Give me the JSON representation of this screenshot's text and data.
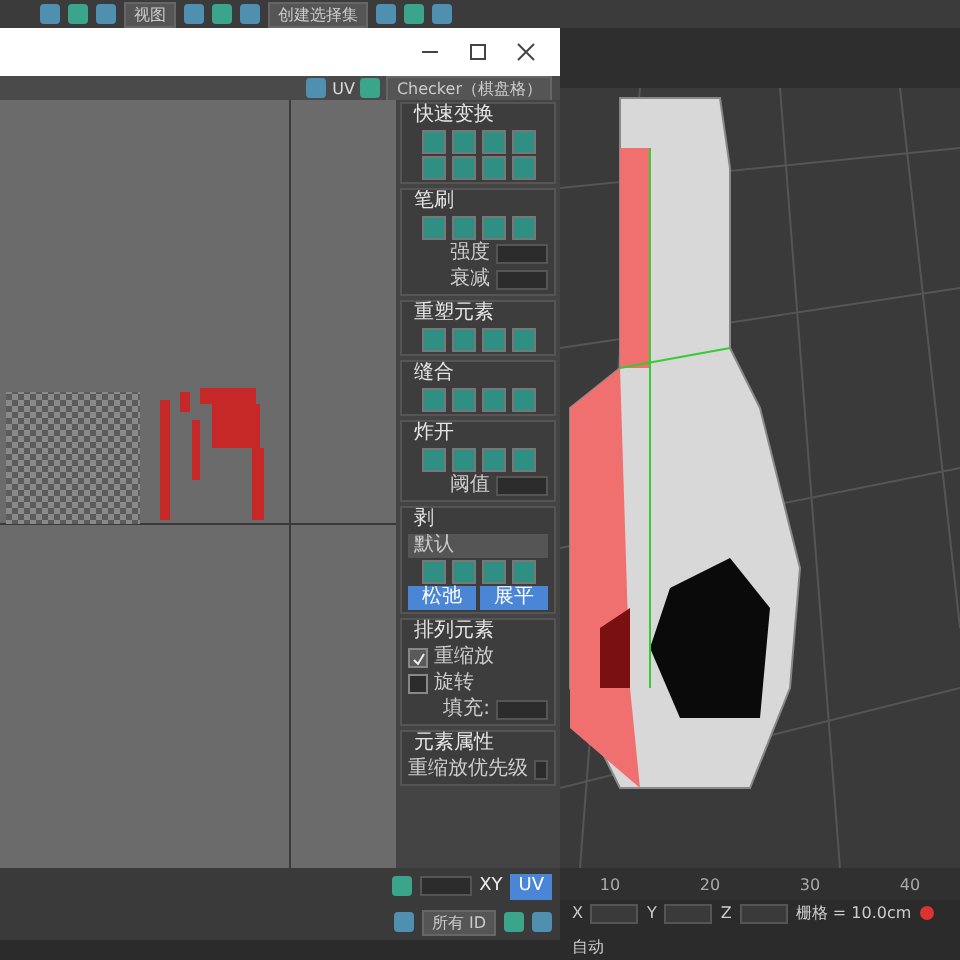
{
  "main_toolbar": {
    "dropdowns": [
      "视图",
      "创建选择集"
    ]
  },
  "uv_editor": {
    "toolbar": {
      "mode_label": "UV",
      "map_dropdown": "Checker（棋盘格）"
    },
    "rollouts": [
      {
        "title": "快速变换",
        "expanded": true,
        "rows": [
          {
            "kind": "icons"
          },
          {
            "kind": "icons"
          }
        ]
      },
      {
        "title": "笔刷",
        "expanded": true,
        "rows": [
          {
            "kind": "icons"
          },
          {
            "kind": "field",
            "label": "强度"
          },
          {
            "kind": "field",
            "label": "衰减"
          }
        ]
      },
      {
        "title": "重塑元素",
        "expanded": true,
        "rows": [
          {
            "kind": "icons"
          }
        ]
      },
      {
        "title": "缝合",
        "expanded": true,
        "rows": [
          {
            "kind": "icons"
          }
        ]
      },
      {
        "title": "炸开",
        "expanded": true,
        "rows": [
          {
            "kind": "icons"
          },
          {
            "kind": "field",
            "label": "阈值"
          }
        ]
      },
      {
        "title": "剥",
        "expanded": true,
        "rows": [
          {
            "kind": "dropdown",
            "label": "默认"
          },
          {
            "kind": "icons"
          },
          {
            "kind": "buttons",
            "labels": [
              "松弛",
              "展平"
            ]
          }
        ]
      },
      {
        "title": "排列元素",
        "expanded": true,
        "rows": [
          {
            "kind": "check",
            "label": "重缩放",
            "checked": true
          },
          {
            "kind": "check",
            "label": "旋转",
            "checked": false
          },
          {
            "kind": "field",
            "label": "填充:"
          }
        ]
      },
      {
        "title": "元素属性",
        "expanded": true,
        "rows": [
          {
            "kind": "field",
            "label": "重缩放优先级"
          }
        ]
      }
    ],
    "bottom_toolbar": {
      "axis_label": "XY",
      "uv_button": "UV",
      "id_dropdown": "所有 ID"
    }
  },
  "timeline": {
    "ticks": [
      "10",
      "20",
      "30",
      "40"
    ]
  },
  "status_bar": {
    "coords": [
      "X",
      "Y",
      "Z"
    ],
    "grid": "栅格 = 10.0cm",
    "auto_key": "自动"
  }
}
